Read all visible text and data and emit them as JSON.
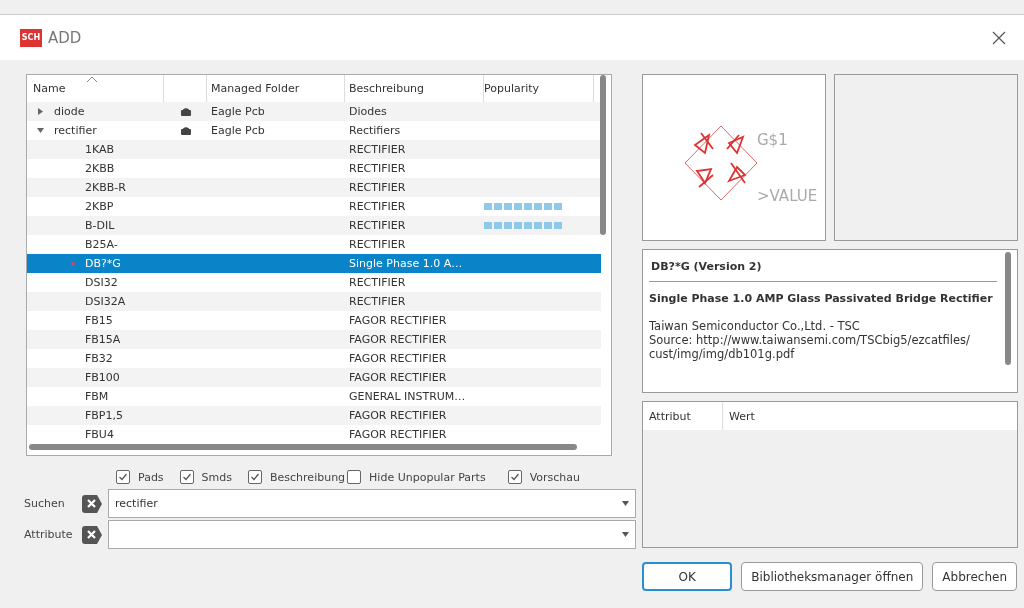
{
  "window": {
    "title": "ADD",
    "icon_text": "SCH"
  },
  "table": {
    "columns": [
      "Name",
      "Managed Folder",
      "Beschreibung",
      "Popularity"
    ],
    "rows": [
      {
        "name": "diode",
        "expanded": false,
        "locked": true,
        "folder": "Eagle Pcb",
        "description": "Diodes",
        "selected": false
      },
      {
        "name": "rectifier",
        "expanded": true,
        "locked": true,
        "folder": "Eagle Pcb",
        "description": "Rectifiers",
        "selected": false,
        "children": [
          {
            "name": "1KAB",
            "description": "RECTIFIER",
            "selected": false
          },
          {
            "name": "2KBB",
            "description": "RECTIFIER",
            "selected": false
          },
          {
            "name": "2KBB-R",
            "description": "RECTIFIER",
            "selected": false
          },
          {
            "name": "2KBP",
            "description": "RECTIFIER",
            "selected": false,
            "level": 1
          },
          {
            "name": "B-DIL",
            "description": "RECTIFIER",
            "selected": false,
            "level": 1
          },
          {
            "name": "B25A-",
            "description": "RECTIFIER",
            "selected": false
          },
          {
            "name": "DB?*G",
            "description": "Single Phase 1.0 A…",
            "selected": true
          },
          {
            "name": "DSI32",
            "description": "RECTIFIER",
            "selected": false
          },
          {
            "name": "DSI32A",
            "description": "RECTIFIER",
            "selected": false
          },
          {
            "name": "FB15",
            "description": "FAGOR RECTIFIER",
            "selected": false
          },
          {
            "name": "FB15A",
            "description": "FAGOR RECTIFIER",
            "selected": false
          },
          {
            "name": "FB32",
            "description": "FAGOR RECTIFIER",
            "selected": false
          },
          {
            "name": "FB100",
            "description": "FAGOR RECTIFIER",
            "selected": false
          },
          {
            "name": "FBM",
            "description": "GENERAL INSTRUM…",
            "selected": false
          },
          {
            "name": "FBP1,5",
            "description": "FAGOR RECTIFIER",
            "selected": false
          },
          {
            "name": "FBU4",
            "description": "FAGOR RECTIFIER",
            "selected": false
          }
        ]
      }
    ]
  },
  "options": [
    {
      "label": "Pads",
      "checked": true
    },
    {
      "label": "Smds",
      "checked": true
    },
    {
      "label": "Beschreibung",
      "checked": true
    },
    {
      "label": "Hide Unpopular Parts",
      "checked": false
    },
    {
      "label": "Vorschau",
      "checked": true
    }
  ],
  "search": {
    "label": "Suchen",
    "value": "rectifier"
  },
  "attribute_filter": {
    "label": "Attribute"
  },
  "preview": {
    "name_label": "G$1",
    "value_label": ">VALUE"
  },
  "info": {
    "title": "DB?*G (Version 2)",
    "heading": "Single Phase 1.0 AMP Glass Passivated Bridge Rectifier",
    "lines": [
      "Taiwan Semiconductor Co.,Ltd. - TSC",
      "Source: http://www.taiwansemi.com/TSCbig5/ezcatfiles/ cust/img/img/db101g.pdf"
    ]
  },
  "attributes_table": {
    "columns": [
      "Attribut",
      "Wert"
    ]
  },
  "buttons": [
    {
      "label": "OK",
      "default": true
    },
    {
      "label": "Bibliotheksmanager öffnen",
      "default": false
    },
    {
      "label": "Abbrechen",
      "default": false
    }
  ]
}
